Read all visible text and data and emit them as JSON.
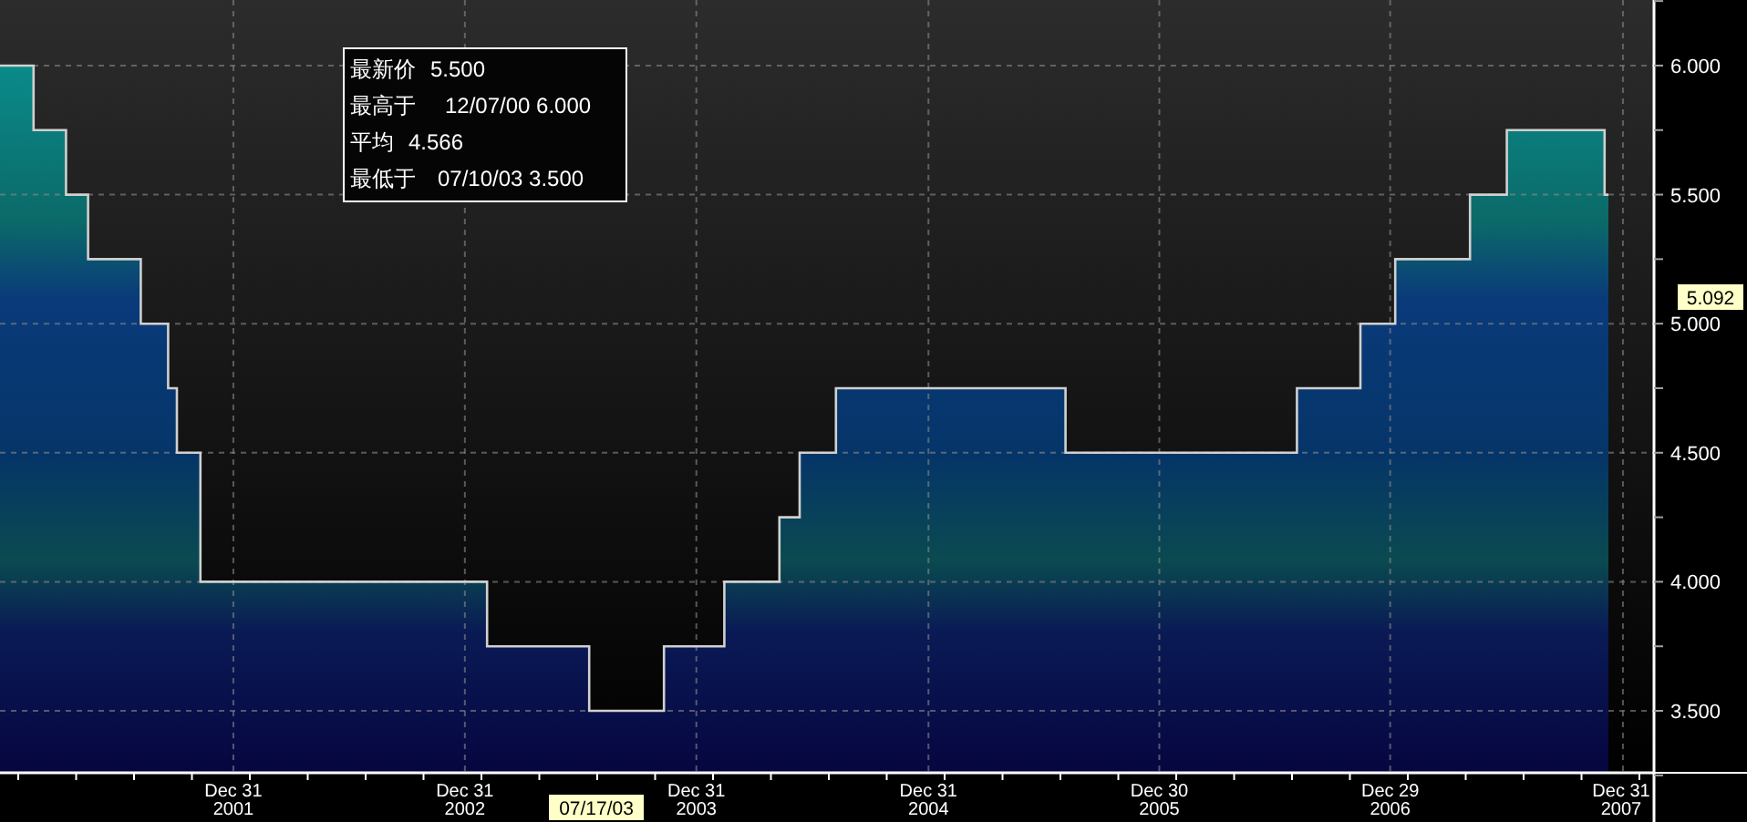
{
  "chart": {
    "chart_data": {
      "type": "area",
      "x": [
        "2000-12-28",
        "2001-02-19",
        "2001-02-19",
        "2001-04-11",
        "2001-04-11",
        "2001-05-16",
        "2001-05-16",
        "2001-08-07",
        "2001-08-07",
        "2001-09-19",
        "2001-09-19",
        "2001-10-03",
        "2001-10-03",
        "2001-11-09",
        "2001-11-09",
        "2003-02-04",
        "2003-02-04",
        "2003-07-15",
        "2003-07-15",
        "2003-11-10",
        "2003-11-10",
        "2004-02-13",
        "2004-02-13",
        "2004-05-10",
        "2004-05-10",
        "2004-06-11",
        "2004-06-11",
        "2004-08-07",
        "2004-08-07",
        "2005-08-04",
        "2005-08-04",
        "2006-08-04",
        "2006-08-04",
        "2006-11-12",
        "2006-11-12",
        "2007-01-06",
        "2007-01-06",
        "2007-05-04",
        "2007-05-04",
        "2007-07-01",
        "2007-07-01",
        "2007-12-02",
        "2007-12-02",
        "2007-12-08"
      ],
      "series": [
        {
          "color": "#d0d0d0",
          "values": [
            6.0,
            6.0,
            5.75,
            5.75,
            5.5,
            5.5,
            5.25,
            5.25,
            5.0,
            5.0,
            4.75,
            4.75,
            4.5,
            4.5,
            4.0,
            4.0,
            3.75,
            3.75,
            3.5,
            3.5,
            3.75,
            3.75,
            4.0,
            4.0,
            4.25,
            4.25,
            4.5,
            4.5,
            4.75,
            4.75,
            4.5,
            4.5,
            4.75,
            4.75,
            5.0,
            5.0,
            5.25,
            5.25,
            5.5,
            5.5,
            5.75,
            5.75,
            5.5,
            5.5
          ]
        }
      ],
      "grid": true,
      "xlim": [
        "2000-12-28",
        "2008-02-18"
      ],
      "ylim": [
        3.26,
        6.254
      ],
      "xticks": [
        {
          "value": "2001-12-31",
          "label": "Dec 31 2001"
        },
        {
          "value": "2002-12-31",
          "label": "Dec 31 2002"
        },
        {
          "value": "2003-12-31",
          "label": "Dec 31 2003"
        },
        {
          "value": "2004-12-31",
          "label": "Dec 31 2004"
        },
        {
          "value": "2005-12-30",
          "label": "Dec 30 2005"
        },
        {
          "value": "2006-12-29",
          "label": "Dec 29 2006"
        },
        {
          "value": "2007-12-31",
          "label": "Dec 31 2007"
        }
      ],
      "yticks": [
        {
          "value": 3.5,
          "label": "3.500"
        },
        {
          "value": 4.0,
          "label": "4.000"
        },
        {
          "value": 4.5,
          "label": "4.500"
        },
        {
          "value": 5.0,
          "label": "5.000"
        },
        {
          "value": 5.5,
          "label": "5.500"
        },
        {
          "value": 6.0,
          "label": "6.000"
        }
      ]
    },
    "legend": [
      {
        "label": "最新价",
        "value": "5.500"
      },
      {
        "label": "最高于",
        "value": "12/07/00 6.000"
      },
      {
        "label": "平均",
        "value": "4.566"
      },
      {
        "label": "最低于",
        "value": "07/10/03 3.500"
      }
    ],
    "current_value_label": "5.092",
    "cursor_date_label": "07/17/03"
  }
}
